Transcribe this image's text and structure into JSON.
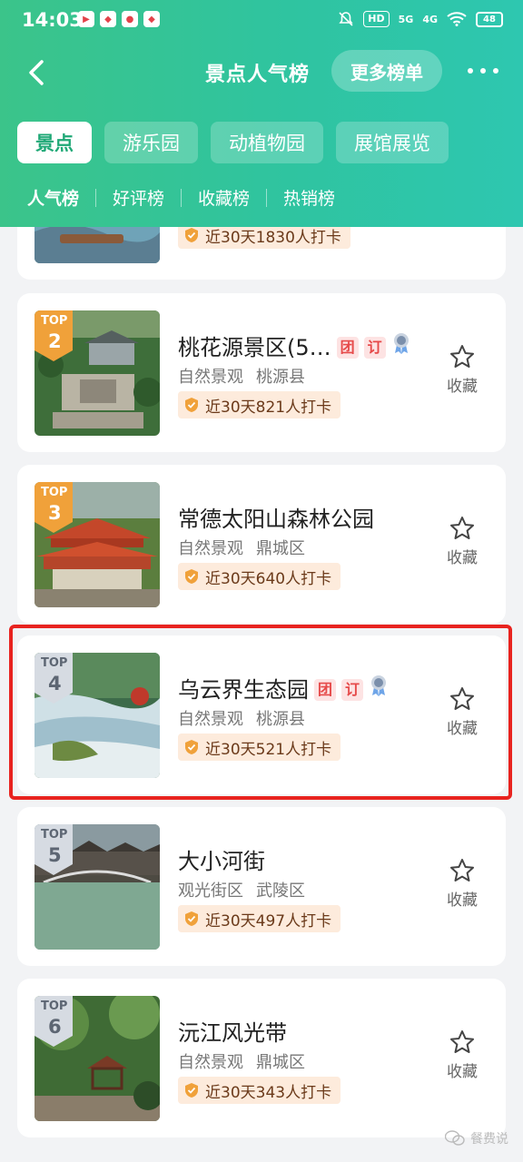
{
  "status_bar": {
    "time": "14:03",
    "signal_labels": [
      "HD",
      "5G",
      "4G"
    ],
    "battery": "48"
  },
  "nav": {
    "title": "景点人气榜",
    "more_lists": "更多榜单"
  },
  "category_tabs": [
    "景点",
    "游乐园",
    "动植物园",
    "展馆展览"
  ],
  "sub_tabs": [
    "人气榜",
    "好评榜",
    "收藏榜",
    "热销榜"
  ],
  "partial_item": {
    "checkin": "近30天1830人打卡"
  },
  "items": [
    {
      "rank_top": "TOP",
      "rank": "2",
      "title": "桃花源景区(5…",
      "tags": [
        "团",
        "订"
      ],
      "category": "自然景观",
      "area": "桃源县",
      "checkin": "近30天821人打卡",
      "fav": "收藏"
    },
    {
      "rank_top": "TOP",
      "rank": "3",
      "title": "常德太阳山森林公园",
      "tags": [],
      "category": "自然景观",
      "area": "鼎城区",
      "checkin": "近30天640人打卡",
      "fav": "收藏"
    },
    {
      "rank_top": "TOP",
      "rank": "4",
      "title": "乌云界生态园",
      "tags": [
        "团",
        "订"
      ],
      "category": "自然景观",
      "area": "桃源县",
      "checkin": "近30天521人打卡",
      "fav": "收藏"
    },
    {
      "rank_top": "TOP",
      "rank": "5",
      "title": "大小河街",
      "tags": [],
      "category": "观光街区",
      "area": "武陵区",
      "checkin": "近30天497人打卡",
      "fav": "收藏"
    },
    {
      "rank_top": "TOP",
      "rank": "6",
      "title": "沅江风光带",
      "tags": [],
      "category": "自然景观",
      "area": "鼎城区",
      "checkin": "近30天343人打卡",
      "fav": "收藏"
    }
  ],
  "watermark": "餐费说",
  "colors": {
    "header_start": "#3bc48a",
    "header_end": "#2ec7b0",
    "active_tab_text": "#1fa876",
    "gold_badge": "#f0a13a",
    "silver_badge": "#c9d0da",
    "tag_red": "#e64a4a",
    "highlight_red": "#e8231f"
  }
}
